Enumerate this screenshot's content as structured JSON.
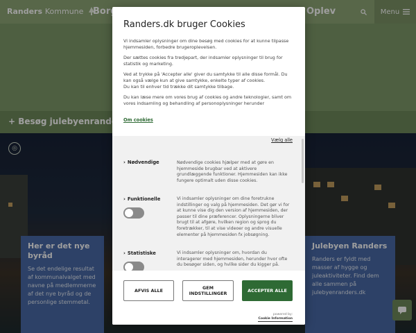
{
  "site": {
    "logo_text": "Randers",
    "logo_sub": "Kommune",
    "nav_left_partial": "Borge",
    "nav_right_partial": "Oplev",
    "menu_label": "Menu",
    "hero_strip_text": "+ Besøg julebyenranders.d",
    "card_left": {
      "title": "Her er det nye byråd",
      "text": "Se det endelige resultat af kommunalvalget med navne på medlemmerne af det nye byråd og de personlige stemmetal."
    },
    "card_right": {
      "title": "Julebyen Randers",
      "text": "Randers er fyldt med masser af hygge og juleaktiviteter. Find dem alle sammen på julebyenranders.dk"
    }
  },
  "cookie_dialog": {
    "title": "Randers.dk bruger Cookies",
    "paragraphs": [
      "Vi indsamler oplysninger om dine besøg med cookies for at kunne tilpasse hjemmesiden, forbedre brugeroplevelsen.",
      "Der sættes cookies fra tredjepart, der indsamler oplysninger til brug for statistik og marketing.",
      "Ved at trykke på 'Accepter alle' giver du samtykke til alle disse formål. Du kan også vælge kun at give samtykke, enkelte typer af cookies.",
      "Du kan til enhver tid trække dit samtykke tilbage.",
      "Du kan læse mere om vores brug af cookies og andre teknologier, samt om vores indsamling og behandling af personoplysninger herunder"
    ],
    "about_link": "Om cookies",
    "choose_all": "Vælg alle",
    "categories": [
      {
        "name": "Nødvendige",
        "description": "Nødvendige cookies hjælper med at gøre en hjemmeside brugbar ved at aktivere grundlæggende funktioner. Hjemmesiden kan ikke fungere optimalt uden disse cookies."
      },
      {
        "name": "Funktionelle",
        "description": "Vi indsamler oplysninger om dine foretrukne indstillinger og valg på hjemmesiden. Det gør vi for at kunne vise dig den version af hjemmesiden, der passer til dine præferencer. Oplysningerne bliver brugt til at afgøre, hvilken region og sprog du foretrækker, til at vise videoer og andre visuelle elementer på hjemmesiden fx jobsøgning."
      },
      {
        "name": "Statistiske",
        "description": "Vi indsamler oplysninger om, hvordan du interagerer med hjemmesiden, herunder hvor ofte du besøger siden, og hvilke sider du kigger på."
      }
    ],
    "buttons": {
      "reject": "AFVIS ALLE",
      "save_line1": "GEM",
      "save_line2": "INDSTILLINGER",
      "accept": "ACCEPTER ALLE"
    },
    "powered_by": "powered by:",
    "powered_brand": "Cookie Information"
  },
  "colors": {
    "brand_green": "#8fa676",
    "accept_green": "#2e6a34",
    "card_blue": "#4a6aa6"
  }
}
